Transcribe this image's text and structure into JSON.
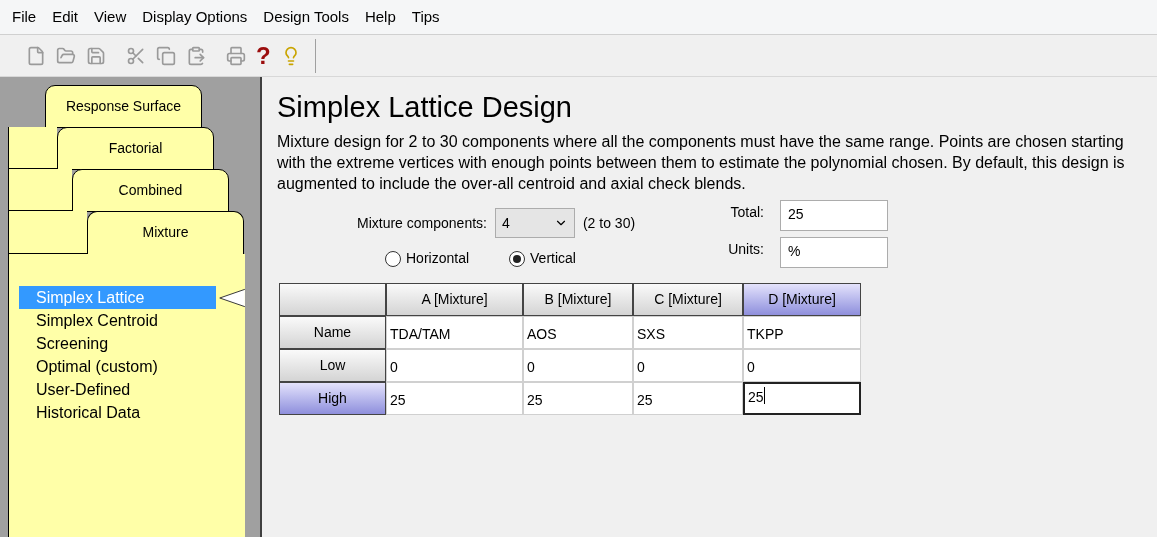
{
  "menu": [
    "File",
    "Edit",
    "View",
    "Display Options",
    "Design Tools",
    "Help",
    "Tips"
  ],
  "toolbar": [
    {
      "kind": "new",
      "disabled": true
    },
    {
      "kind": "open",
      "disabled": true
    },
    {
      "kind": "save",
      "disabled": true
    },
    {
      "kind": "cut",
      "disabled": true
    },
    {
      "kind": "copy",
      "disabled": true
    },
    {
      "kind": "paste",
      "disabled": true
    },
    {
      "kind": "print",
      "disabled": true
    },
    {
      "kind": "help",
      "label": "?",
      "disabled": false
    },
    {
      "kind": "tip",
      "disabled": false
    }
  ],
  "design_tabs": [
    {
      "label": "Response Surface",
      "selected": false
    },
    {
      "label": "Factorial",
      "selected": false
    },
    {
      "label": "Combined",
      "selected": false
    },
    {
      "label": "Mixture",
      "selected": true
    }
  ],
  "design_list": [
    {
      "label": "Simplex Lattice",
      "selected": true
    },
    {
      "label": "Simplex Centroid",
      "selected": false
    },
    {
      "label": "Screening",
      "selected": false
    },
    {
      "label": "Optimal (custom)",
      "selected": false
    },
    {
      "label": "User-Defined",
      "selected": false
    },
    {
      "label": "Historical Data",
      "selected": false
    }
  ],
  "title": "Simplex Lattice Design",
  "description": "Mixture design for 2 to 30 components where all the components must have the same range.  Points are chosen starting with the extreme vertices with enough points between them to estimate the polynomial chosen.  By default, this design is augmented to include the over-all centroid and axial check blends.",
  "components": {
    "label": "Mixture components:",
    "value": "4",
    "range": "(2 to 30)"
  },
  "orientation": [
    {
      "label": "Horizontal",
      "selected": false
    },
    {
      "label": "Vertical",
      "selected": true
    }
  ],
  "total": {
    "label": "Total:",
    "value": "25"
  },
  "units": {
    "label": "Units:",
    "value": "%"
  },
  "table": {
    "columns": [
      {
        "label": "A [Mixture]",
        "selected": false
      },
      {
        "label": "B [Mixture]",
        "selected": false
      },
      {
        "label": "C [Mixture]",
        "selected": false
      },
      {
        "label": "D [Mixture]",
        "selected": true
      }
    ],
    "rows": [
      {
        "label": "Name",
        "selected": false,
        "cells": [
          {
            "value": "TDA/TAM",
            "focused": false
          },
          {
            "value": "AOS",
            "focused": false
          },
          {
            "value": "SXS",
            "focused": false
          },
          {
            "value": "TKPP",
            "focused": false
          }
        ]
      },
      {
        "label": "Low",
        "selected": false,
        "cells": [
          {
            "value": "0",
            "focused": false
          },
          {
            "value": "0",
            "focused": false
          },
          {
            "value": "0",
            "focused": false
          },
          {
            "value": "0",
            "focused": false
          }
        ]
      },
      {
        "label": "High",
        "selected": true,
        "cells": [
          {
            "value": "25",
            "focused": false
          },
          {
            "value": "25",
            "focused": false
          },
          {
            "value": "25",
            "focused": false
          },
          {
            "value": "25",
            "focused": true
          }
        ]
      }
    ]
  }
}
